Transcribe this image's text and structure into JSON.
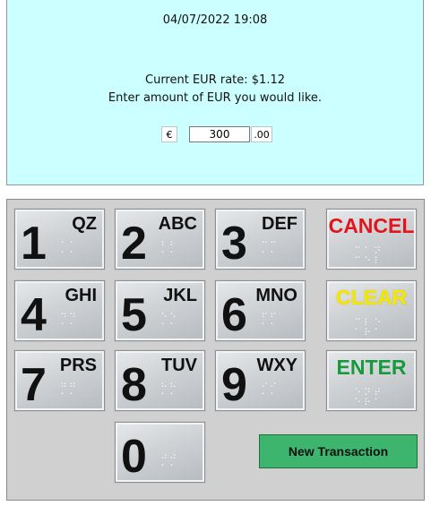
{
  "screen": {
    "datetime": "04/07/2022 19:08",
    "rate_line": "Current EUR rate: $1.12",
    "prompt_line": "Enter amount of EUR you would like.",
    "currency_symbol": "€",
    "amount_value": "300",
    "cents_suffix": ".00",
    "background_color": "#ccffff"
  },
  "keypad": {
    "keys": [
      {
        "digit": "1",
        "letters": "QZ"
      },
      {
        "digit": "2",
        "letters": "ABC"
      },
      {
        "digit": "3",
        "letters": "DEF"
      },
      {
        "digit": "4",
        "letters": "GHI"
      },
      {
        "digit": "5",
        "letters": "JKL"
      },
      {
        "digit": "6",
        "letters": "MNO"
      },
      {
        "digit": "7",
        "letters": "PRS"
      },
      {
        "digit": "8",
        "letters": "TUV"
      },
      {
        "digit": "9",
        "letters": "WXY"
      },
      {
        "digit": "0",
        "letters": ""
      }
    ],
    "cancel_label": "CANCEL",
    "clear_label": "CLEAR",
    "enter_label": "ENTER",
    "cancel_color": "#e0161c",
    "clear_color": "#f5e800",
    "enter_color": "#169a3c"
  },
  "new_transaction_label": "New Transaction",
  "new_transaction_color": "#3db56e"
}
